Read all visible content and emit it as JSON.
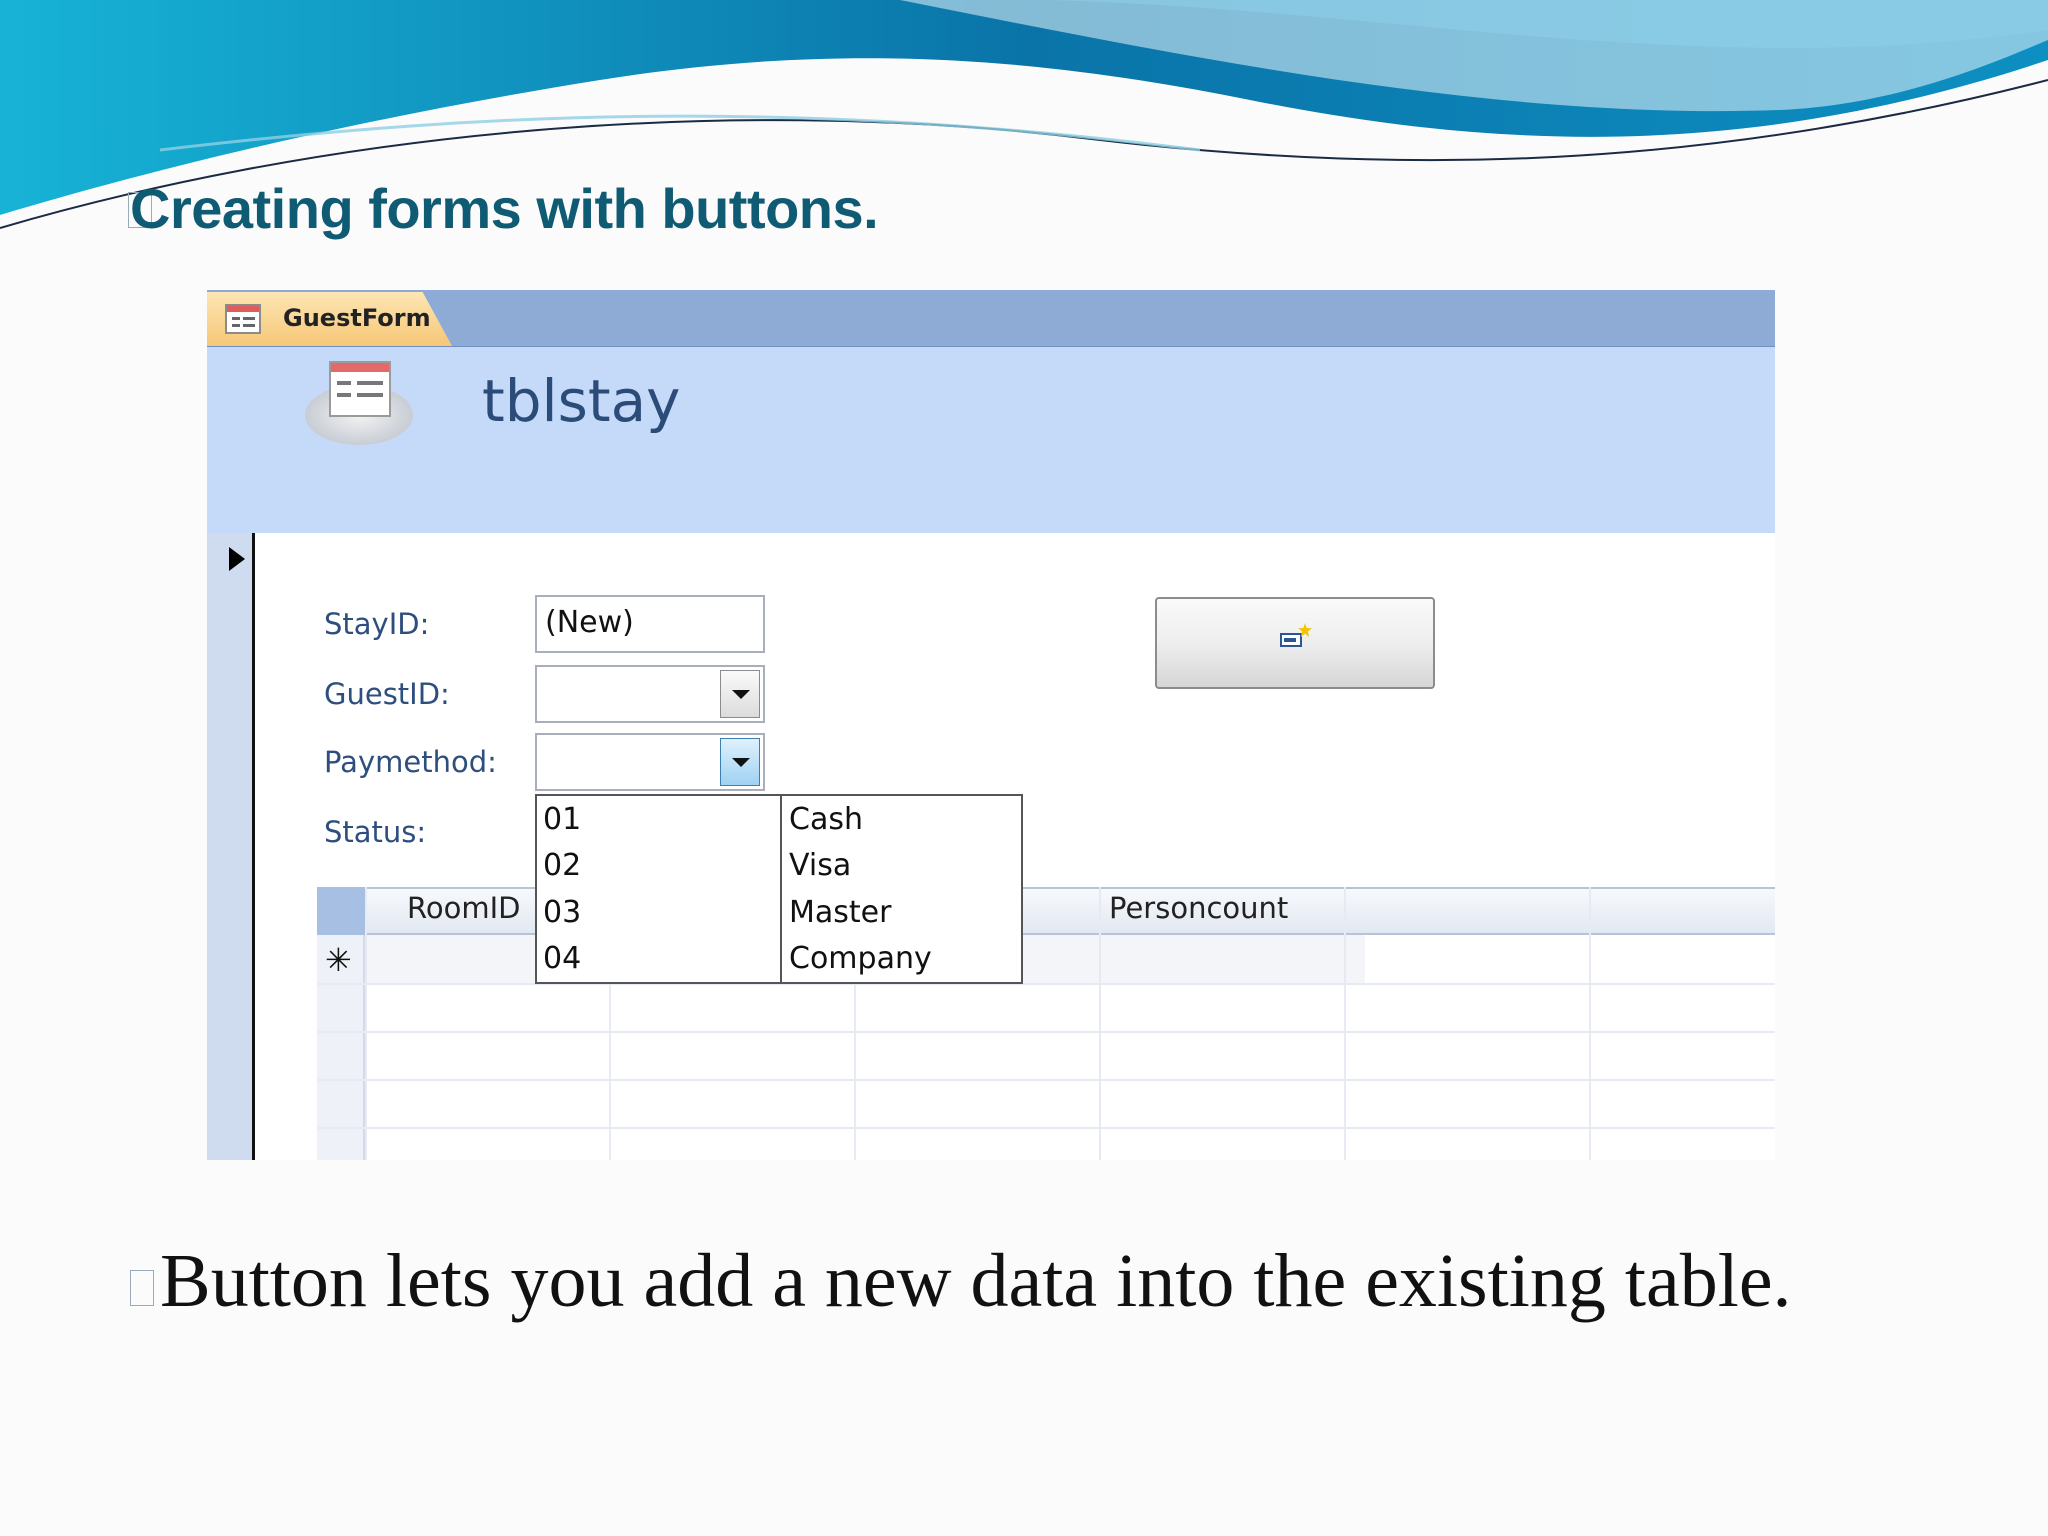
{
  "slide": {
    "title": "Creating forms with buttons.",
    "caption": "Button lets you add a new data into the existing table."
  },
  "access": {
    "tab_label": "GuestForm",
    "form_title": "tblstay",
    "fields": {
      "stayid_label": "StayID:",
      "stayid_value": "(New)",
      "guestid_label": "GuestID:",
      "paymethod_label": "Paymethod:",
      "status_label": "Status:"
    },
    "subform": {
      "columns": [
        "RoomID",
        "Personcount"
      ],
      "new_row_marker": "✳"
    },
    "paymethod_options": [
      {
        "code": "01",
        "name": "Cash"
      },
      {
        "code": "02",
        "name": "Visa"
      },
      {
        "code": "03",
        "name": "Master"
      },
      {
        "code": "04",
        "name": "Company"
      }
    ]
  },
  "colors": {
    "title": "#0f5b73",
    "label": "#2e4f7e",
    "header_bg": "#c5d9f9",
    "tabbar_bg": "#8eabd6"
  },
  "icons": [
    "form-icon",
    "record-selector-arrow-icon",
    "dropdown-arrow-icon",
    "new-record-icon"
  ]
}
